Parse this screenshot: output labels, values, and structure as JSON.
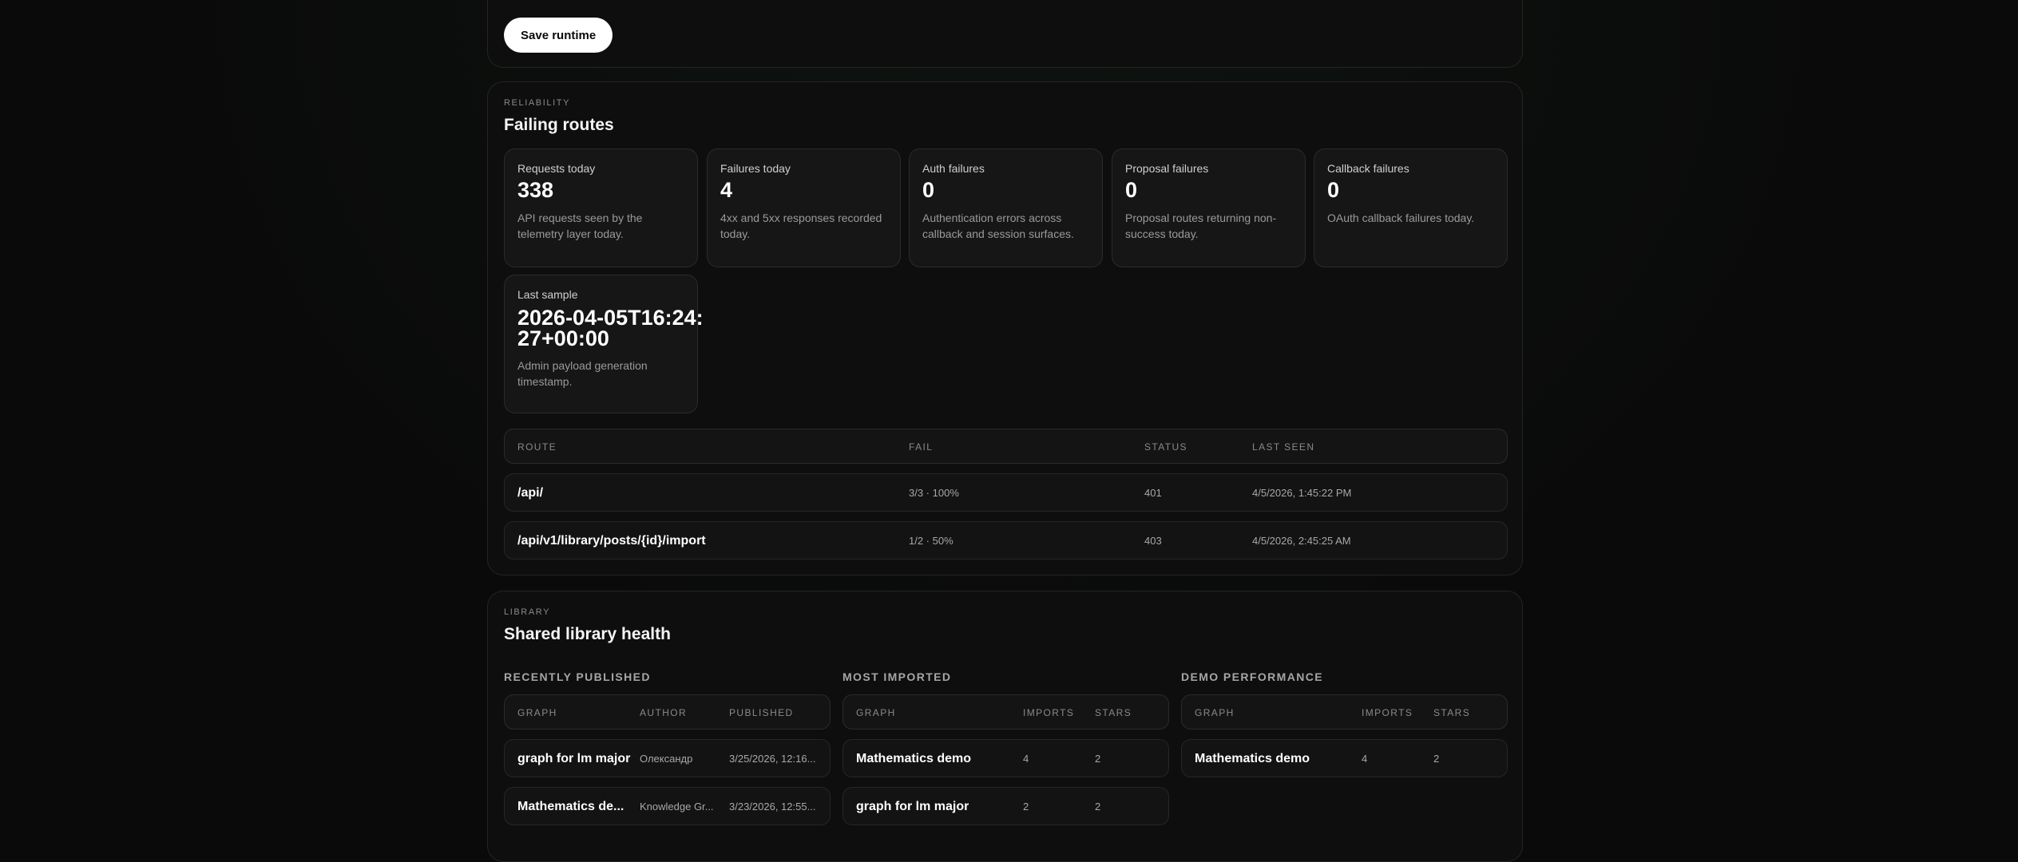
{
  "runtime": {
    "save_label": "Save runtime"
  },
  "reliability": {
    "eyebrow": "RELIABILITY",
    "title": "Failing routes",
    "cards": [
      {
        "label": "Requests today",
        "value": "338",
        "desc": "API requests seen by the telemetry layer today."
      },
      {
        "label": "Failures today",
        "value": "4",
        "desc": "4xx and 5xx responses recorded today."
      },
      {
        "label": "Auth failures",
        "value": "0",
        "desc": "Authentication errors across callback and session surfaces."
      },
      {
        "label": "Proposal failures",
        "value": "0",
        "desc": "Proposal routes returning non-success today."
      },
      {
        "label": "Callback failures",
        "value": "0",
        "desc": "OAuth callback failures today."
      },
      {
        "label": "Last sample",
        "value": "2026-04-05T16:24:27+00:00",
        "desc": "Admin payload generation timestamp."
      }
    ],
    "table": {
      "headers": {
        "route": "ROUTE",
        "fail": "FAIL",
        "status": "STATUS",
        "last_seen": "LAST SEEN"
      },
      "rows": [
        {
          "route": "/api/",
          "fail": "3/3 · 100%",
          "status": "401",
          "last_seen": "4/5/2026, 1:45:22 PM"
        },
        {
          "route": "/api/v1/library/posts/{id}/import",
          "fail": "1/2 · 50%",
          "status": "403",
          "last_seen": "4/5/2026, 2:45:25 AM"
        }
      ]
    }
  },
  "library": {
    "eyebrow": "LIBRARY",
    "title": "Shared library health",
    "recently_published": {
      "title": "RECENTLY PUBLISHED",
      "headers": {
        "graph": "GRAPH",
        "author": "AUTHOR",
        "published": "PUBLISHED"
      },
      "rows": [
        {
          "graph": "graph for lm major",
          "author": "Олександр",
          "published": "3/25/2026, 12:16..."
        },
        {
          "graph": "Mathematics de...",
          "author": "Knowledge Gr...",
          "published": "3/23/2026, 12:55..."
        }
      ]
    },
    "most_imported": {
      "title": "MOST IMPORTED",
      "headers": {
        "graph": "GRAPH",
        "imports": "IMPORTS",
        "stars": "STARS"
      },
      "rows": [
        {
          "graph": "Mathematics demo",
          "imports": "4",
          "stars": "2"
        },
        {
          "graph": "graph for lm major",
          "imports": "2",
          "stars": "2"
        }
      ]
    },
    "demo_performance": {
      "title": "DEMO PERFORMANCE",
      "headers": {
        "graph": "GRAPH",
        "imports": "IMPORTS",
        "stars": "STARS"
      },
      "rows": [
        {
          "graph": "Mathematics demo",
          "imports": "4",
          "stars": "2"
        }
      ]
    }
  }
}
